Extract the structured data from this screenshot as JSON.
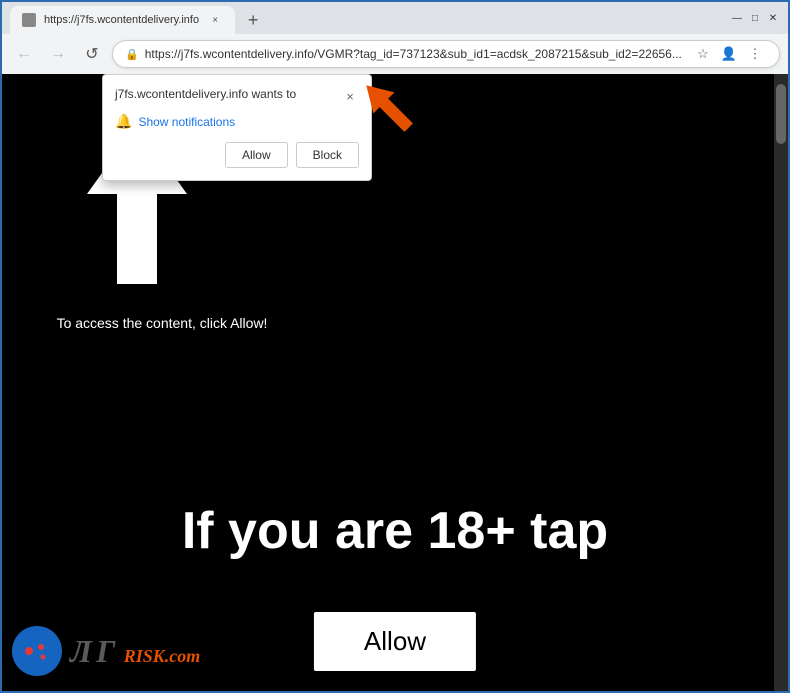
{
  "browser": {
    "tab": {
      "favicon": "page-icon",
      "title": "https://j7fs.wcontentdelivery.info",
      "close_label": "×"
    },
    "new_tab_label": "+",
    "window_controls": {
      "minimize": "—",
      "maximize": "□",
      "close": "✕"
    },
    "address_bar": {
      "lock_icon": "🔒",
      "url": "https://j7fs.wcontentdelivery.info/VGMR?tag_id=737123&sub_id1=acdsk_2087215&sub_id2=22656...",
      "bookmark_icon": "☆",
      "account_icon": "👤",
      "menu_icon": "⋮"
    },
    "back_btn": "←",
    "forward_btn": "→",
    "refresh_btn": "↺"
  },
  "notification_popup": {
    "site_text": "j7fs.wcontentdelivery.info wants to",
    "close_label": "×",
    "bell_icon": "🔔",
    "show_notifications_label": "Show notifications",
    "allow_button_label": "Allow",
    "block_button_label": "Block"
  },
  "page_content": {
    "main_text": "To access the content, click Allow!",
    "big_text": "If you are 18+ tap",
    "allow_button_label": "Allow"
  },
  "pcrisk": {
    "text": "ЛГ",
    "dot_com": "RISK.com"
  }
}
